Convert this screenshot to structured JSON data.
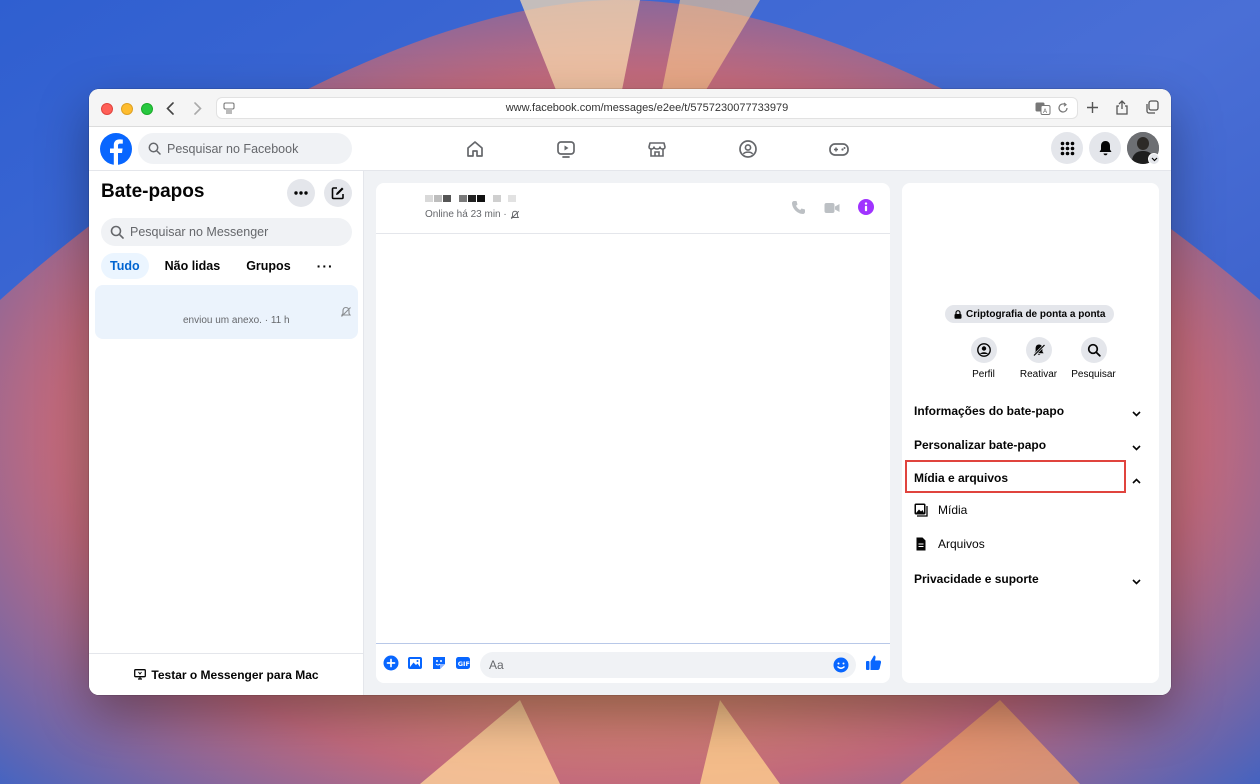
{
  "browser": {
    "url": "www.facebook.com/messages/e2ee/t/5757230077733979"
  },
  "header": {
    "search_placeholder": "Pesquisar no Facebook",
    "nav_icons": [
      "home-icon",
      "video-icon",
      "marketplace-icon",
      "groups-icon",
      "gaming-icon"
    ]
  },
  "sidebar": {
    "title": "Bate-papos",
    "search_placeholder": "Pesquisar no Messenger",
    "tabs": [
      {
        "label": "Tudo",
        "active": true
      },
      {
        "label": "Não lidas",
        "active": false
      },
      {
        "label": "Grupos",
        "active": false
      },
      {
        "label": "···",
        "active": false
      }
    ],
    "conversation": {
      "snippet": "enviou um anexo. · 11 h"
    },
    "footer": "Testar o Messenger para Mac"
  },
  "chat": {
    "status": "Online há 23 min ·",
    "composer_placeholder": "Aa"
  },
  "info": {
    "e2e_label": "Criptografia de ponta a ponta",
    "actions": [
      {
        "label": "Perfil",
        "icon": "profile-icon"
      },
      {
        "label": "Reativar",
        "icon": "bell-muted-icon"
      },
      {
        "label": "Pesquisar",
        "icon": "search-icon"
      }
    ],
    "sections": {
      "chat_info": "Informações do bate-papo",
      "customize": "Personalizar bate-papo",
      "media_files": "Mídia e arquivos",
      "media": "Mídia",
      "files": "Arquivos",
      "privacy": "Privacidade e suporte"
    }
  },
  "colors": {
    "fb_blue": "#0866ff",
    "messenger_purple": "#a033ff",
    "highlight_red": "#e0443e"
  }
}
